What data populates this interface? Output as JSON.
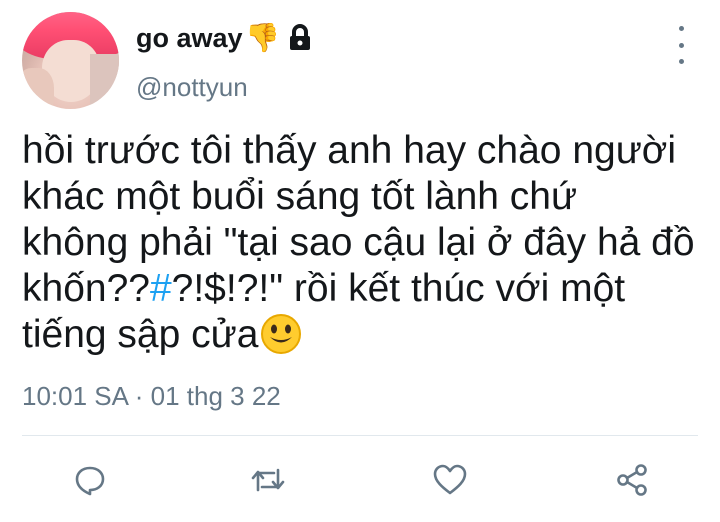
{
  "tweet": {
    "display_name": "go away",
    "handle": "@nottyun",
    "text_before_hashtag": "hồi trước tôi thấy anh hay chào người\nkhác một buổi sáng tốt lành chứ\nkhông phải \"tại sao cậu lại ở đây hả đồ\nkhốn??",
    "hashtag": "#",
    "text_after_hashtag": "?!$!?!\" rồi kết thúc với một\ntiếng sập cửa",
    "timestamp": "10:01 SA · 01 thg 3 22"
  },
  "icons": {
    "name_emoji": "thumbs-down-icon",
    "lock": "lock-icon",
    "more": "more-vertical-icon",
    "end_emoji": "smiling-face-icon",
    "actions": [
      "reply-icon",
      "retweet-icon",
      "like-icon",
      "share-icon"
    ]
  },
  "colors": {
    "text": "#14171a",
    "secondary": "#657786",
    "hashtag": "#1da1f2",
    "divider": "#e1e8ed",
    "emoji": "#f5b400"
  }
}
